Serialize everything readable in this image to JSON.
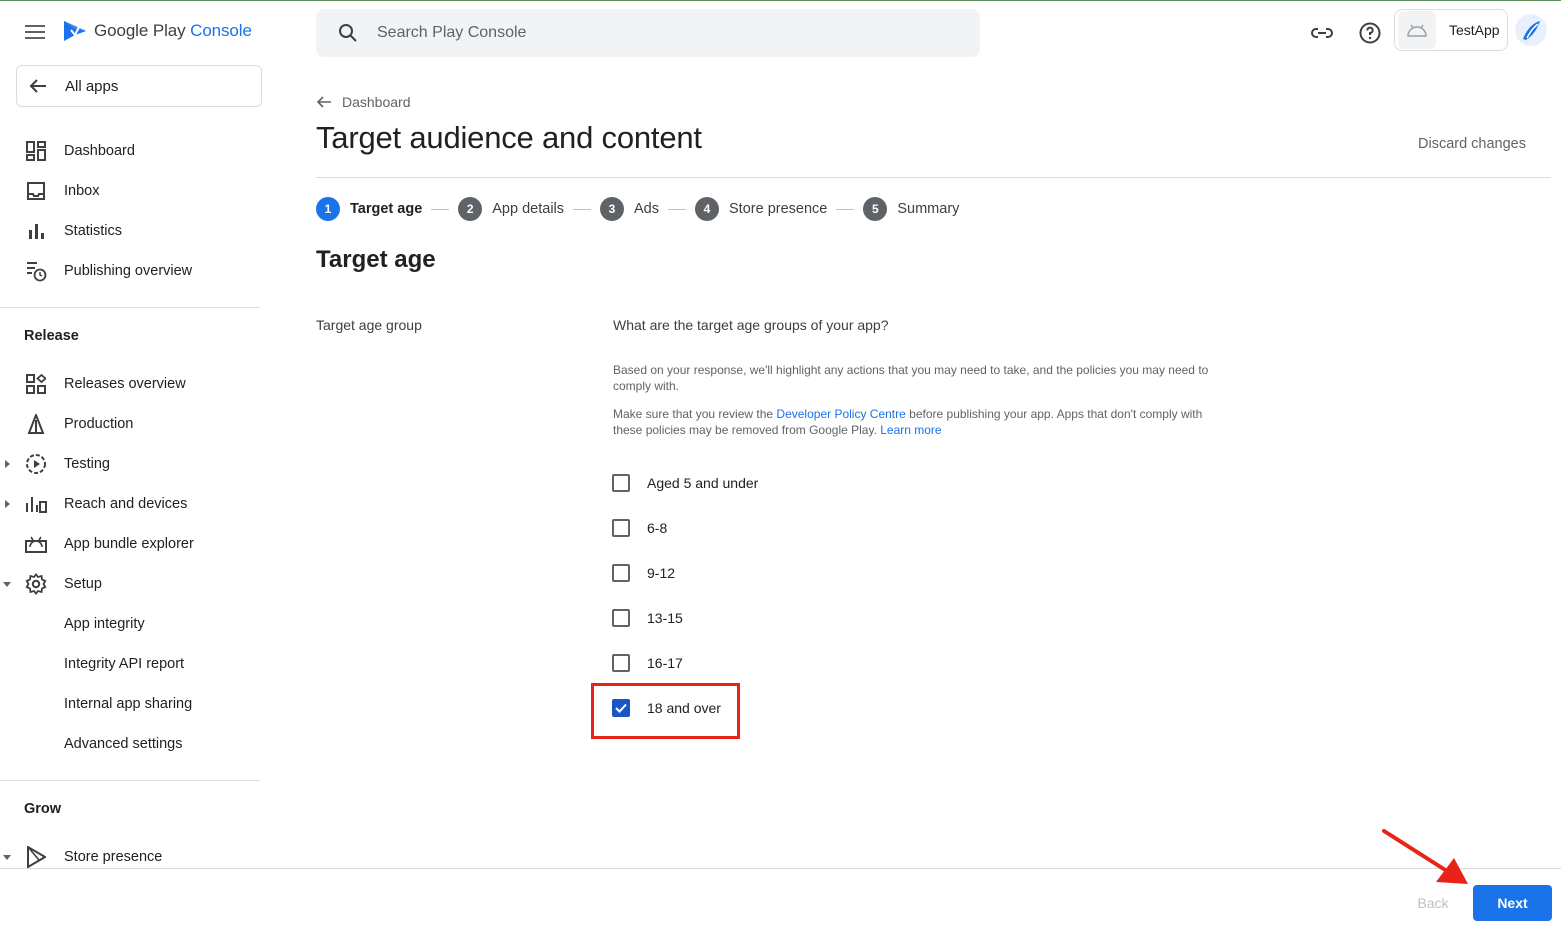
{
  "header": {
    "logo_text_main": "Google Play",
    "logo_text_accent": "Console",
    "search_placeholder": "Search Play Console",
    "app_name": "TestApp"
  },
  "sidebar": {
    "all_apps_label": "All apps",
    "top_items": [
      {
        "label": "Dashboard",
        "icon": "dashboard-icon"
      },
      {
        "label": "Inbox",
        "icon": "inbox-icon"
      },
      {
        "label": "Statistics",
        "icon": "statistics-icon"
      },
      {
        "label": "Publishing overview",
        "icon": "publishing-overview-icon"
      }
    ],
    "release_section": "Release",
    "release_items": [
      {
        "label": "Releases overview",
        "icon": "releases-overview-icon"
      },
      {
        "label": "Production",
        "icon": "production-icon"
      },
      {
        "label": "Testing",
        "icon": "testing-icon",
        "expandable": true,
        "expanded": false
      },
      {
        "label": "Reach and devices",
        "icon": "reach-devices-icon",
        "expandable": true,
        "expanded": false
      },
      {
        "label": "App bundle explorer",
        "icon": "app-bundle-icon"
      },
      {
        "label": "Setup",
        "icon": "setup-gear-icon",
        "expandable": true,
        "expanded": true
      }
    ],
    "setup_subitems": [
      {
        "label": "App integrity"
      },
      {
        "label": "Integrity API report"
      },
      {
        "label": "Internal app sharing"
      },
      {
        "label": "Advanced settings"
      }
    ],
    "grow_section": "Grow",
    "grow_items": [
      {
        "label": "Store presence",
        "icon": "store-presence-icon",
        "expandable": true,
        "expanded": true
      }
    ]
  },
  "main": {
    "back_label": "Dashboard",
    "title": "Target audience and content",
    "discard_label": "Discard changes",
    "steps": [
      {
        "number": "1",
        "label": "Target age",
        "active": true
      },
      {
        "number": "2",
        "label": "App details",
        "active": false
      },
      {
        "number": "3",
        "label": "Ads",
        "active": false
      },
      {
        "number": "4",
        "label": "Store presence",
        "active": false
      },
      {
        "number": "5",
        "label": "Summary",
        "active": false
      }
    ],
    "section_title": "Target age",
    "field_label": "Target age group",
    "question": "What are the target age groups of your app?",
    "help_text_1": "Based on your response, we'll highlight any actions that you may need to take, and the policies you may need to comply with.",
    "help_text_2_pre": "Make sure that you review the ",
    "help_text_2_link": "Developer Policy Centre",
    "help_text_2_post": " before publishing your app. Apps that don't comply with these policies may be removed from Google Play. ",
    "help_text_2_learn": "Learn more",
    "options": [
      {
        "label": "Aged 5 and under",
        "checked": false
      },
      {
        "label": "6-8",
        "checked": false
      },
      {
        "label": "9-12",
        "checked": false
      },
      {
        "label": "13-15",
        "checked": false
      },
      {
        "label": "16-17",
        "checked": false
      },
      {
        "label": "18 and over",
        "checked": true
      }
    ]
  },
  "footer": {
    "back_label": "Back",
    "next_label": "Next"
  },
  "colors": {
    "accent": "#1a73e8",
    "checkbox_checked": "#1a56c4",
    "annotation_red": "#e8231a"
  }
}
